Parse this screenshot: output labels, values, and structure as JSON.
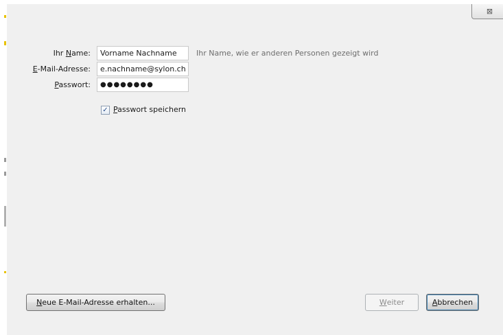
{
  "title_bar": {
    "close_symbol": "⊠"
  },
  "form": {
    "name": {
      "label_before": "Ihr ",
      "label_mnemonic": "N",
      "label_after": "ame:",
      "value": "Vorname Nachname",
      "hint": "Ihr Name, wie er anderen Personen gezeigt wird"
    },
    "email": {
      "label_mnemonic": "E",
      "label_after": "-Mail-Adresse:",
      "value": "e.nachname@sylon.ch"
    },
    "password": {
      "label_mnemonic": "P",
      "label_after": "asswort:",
      "value": "●●●●●●●●"
    },
    "remember": {
      "checked": true,
      "check_mark": "✓",
      "label_mnemonic": "P",
      "label_after": "asswort speichern"
    }
  },
  "buttons": {
    "new_address": {
      "mnemonic": "N",
      "rest": "eue E-Mail-Adresse erhalten..."
    },
    "continue": {
      "mnemonic": "W",
      "rest": "eiter",
      "enabled": false
    },
    "cancel": {
      "mnemonic": "A",
      "rest": "bbrechen"
    }
  },
  "colors": {
    "dialog_bg": "#f0f0f0",
    "default_button_ring": "#3c7fb1"
  }
}
